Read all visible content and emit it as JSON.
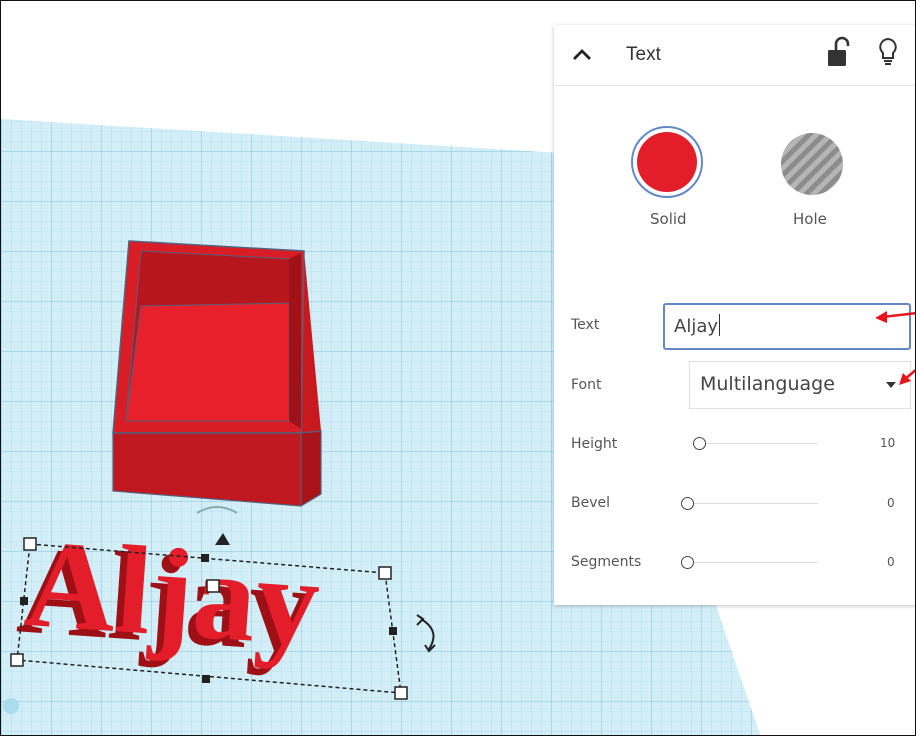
{
  "panel": {
    "title": "Text",
    "collapse_icon": "chevron-up-icon",
    "lock_icon": "unlock-icon",
    "bulb_icon": "lightbulb-icon",
    "solid_label": "Solid",
    "hole_label": "Hole",
    "solid_color": "#e31e2a",
    "props": [
      {
        "label": "Text",
        "value": "Aljay"
      },
      {
        "label": "Font",
        "value": "Multilanguage"
      },
      {
        "label": "Height",
        "value": "10",
        "level": 0
      },
      {
        "label": "Bevel",
        "value": "0",
        "level": 0
      },
      {
        "label": "Segments",
        "value": "0",
        "level": 0
      }
    ]
  },
  "scene": {
    "text_object": "Aljay",
    "grid_color": "#bfe3f0",
    "shape_color": "#e31e2a"
  }
}
